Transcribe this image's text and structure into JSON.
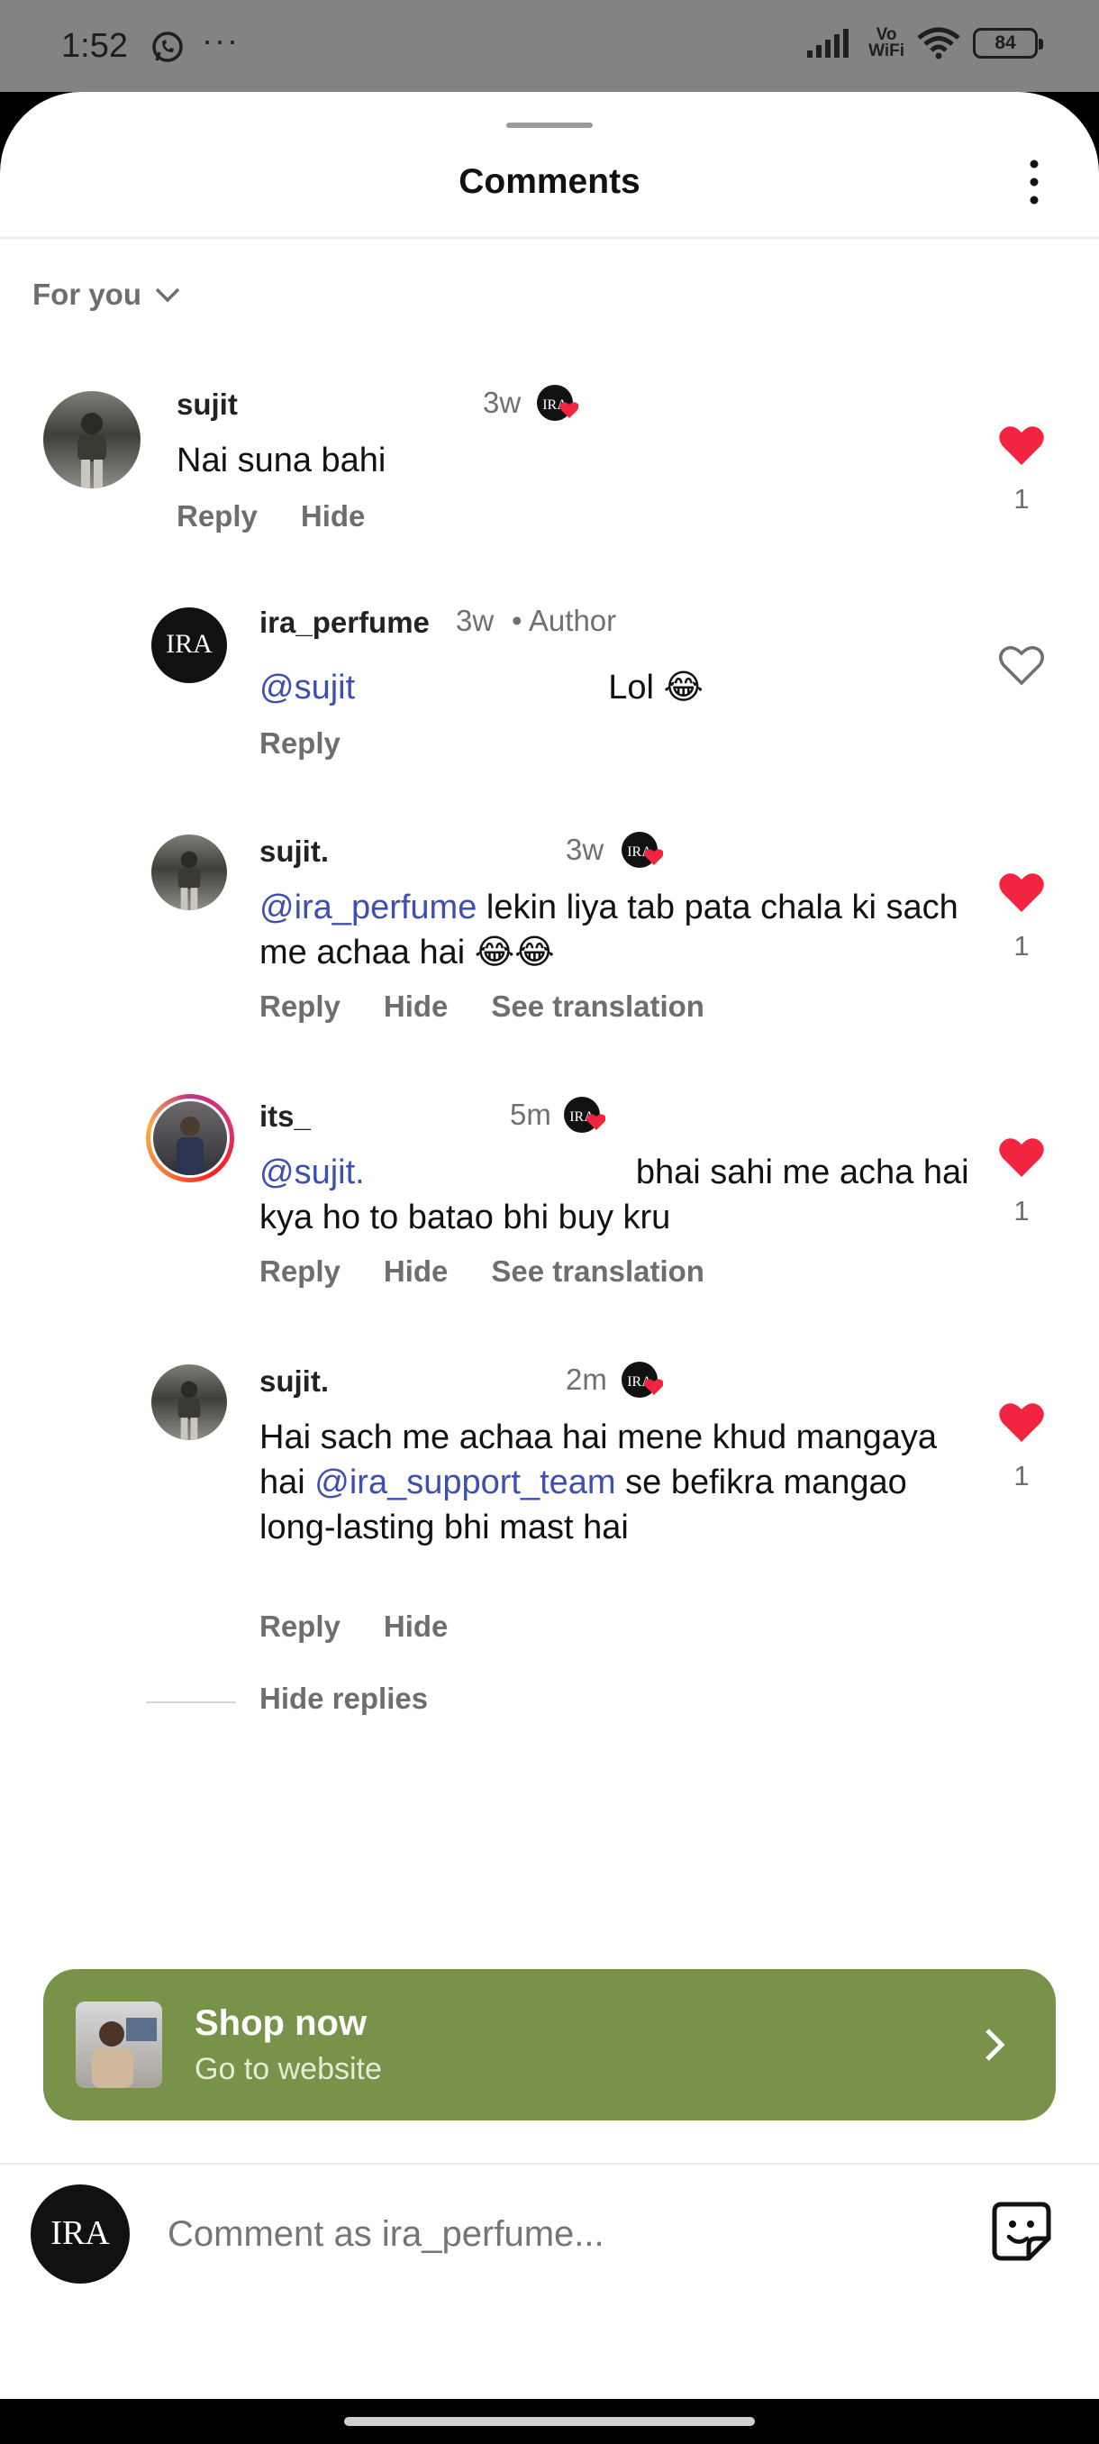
{
  "status_bar": {
    "time": "1:52",
    "net_top": "Vo",
    "net_bottom": "WiFi",
    "battery": "84"
  },
  "header": {
    "title": "Comments"
  },
  "filter": {
    "label": "For you"
  },
  "comments": [
    {
      "username": "sujit",
      "time": "3w",
      "text": "Nai suna bahi",
      "actions": [
        "Reply",
        "Hide"
      ],
      "liked": true,
      "likes": "1"
    },
    {
      "username": "ira_perfume",
      "time": "3w",
      "author_label": "Author",
      "mention": "@sujit",
      "text": "Lol 😂",
      "actions": [
        "Reply"
      ],
      "liked": false
    },
    {
      "username": "sujit.",
      "time": "3w",
      "mention": "@ira_perfume",
      "text": "lekin liya tab pata chala ki sach me achaa hai 😂😂",
      "actions": [
        "Reply",
        "Hide",
        "See translation"
      ],
      "liked": true,
      "likes": "1"
    },
    {
      "username": "its_",
      "time": "5m",
      "mention": "@sujit.",
      "text": "bhai sahi me acha hai kya  ho to batao bhi buy kru",
      "actions": [
        "Reply",
        "Hide",
        "See translation"
      ],
      "liked": true,
      "likes": "1"
    },
    {
      "username": "sujit.",
      "time": "2m",
      "text_before": "Hai sach me achaa hai mene khud mangaya hai",
      "mention": "@ira_support_team",
      "text_after": "se befikra mangao long-lasting bhi mast hai",
      "actions": [
        "Reply",
        "Hide"
      ],
      "liked": true,
      "likes": "1"
    }
  ],
  "hide_replies": "Hide replies",
  "shop": {
    "title": "Shop now",
    "subtitle": "Go to website"
  },
  "composer": {
    "placeholder": "Comment as ira_perfume..."
  },
  "brand_logo": "IRA",
  "colors": {
    "accent_green": "#79924a",
    "like_red": "#f2243f",
    "mention_blue": "#3d4fb3"
  }
}
